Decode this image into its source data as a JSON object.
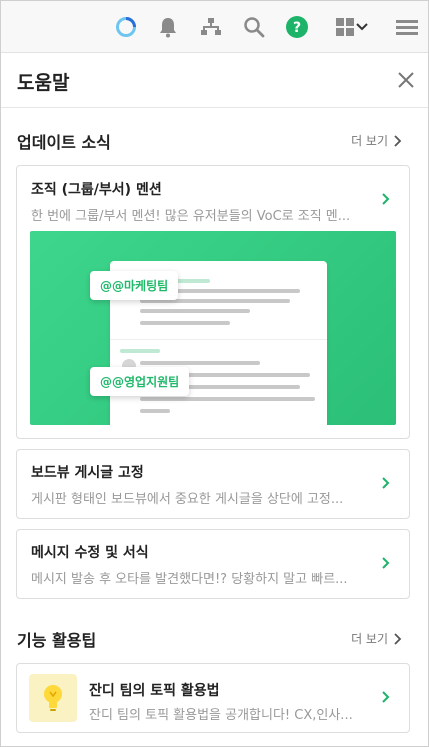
{
  "topbar": {
    "icons": [
      "loading-ring-icon",
      "bell-icon",
      "org-chart-icon",
      "search-icon",
      "help-icon",
      "apps-grid-icon",
      "chevron-down-icon",
      "menu-icon"
    ],
    "help_glyph": "?",
    "accent": "#1db46a"
  },
  "header": {
    "title": "도움말"
  },
  "updates": {
    "title": "업데이트 소식",
    "more_label": "더 보기",
    "cards": [
      {
        "title": "조직 (그룹/부서) 멘션",
        "desc": "한 번에 그룹/부서 멘션! 많은 유저분들의 VoC로 조직 멘..."
      },
      {
        "title": "보드뷰 게시글 고정",
        "desc": "게시판 형태인 보드뷰에서 중요한 게시글을 상단에 고정..."
      },
      {
        "title": "메시지 수정 및 서식",
        "desc": "메시지 발송 후 오타를 발견했다면!? 당황하지 말고 빠르..."
      }
    ],
    "banner": {
      "tag_1": "@@마케팅팀",
      "tag_2": "@@영업지원팀",
      "colors": {
        "bg_start": "#3dd68c",
        "bg_end": "#2bbf77",
        "tag_text": "#1fb96a"
      }
    }
  },
  "tips": {
    "title": "기능 활용팁",
    "more_label": "더 보기",
    "cards": [
      {
        "title": "잔디 팀의 토픽 활용법",
        "desc": "잔디 팀의 토픽 활용법을 공개합니다! CX,인사...",
        "thumb_icon": "lightbulb-icon"
      }
    ]
  }
}
